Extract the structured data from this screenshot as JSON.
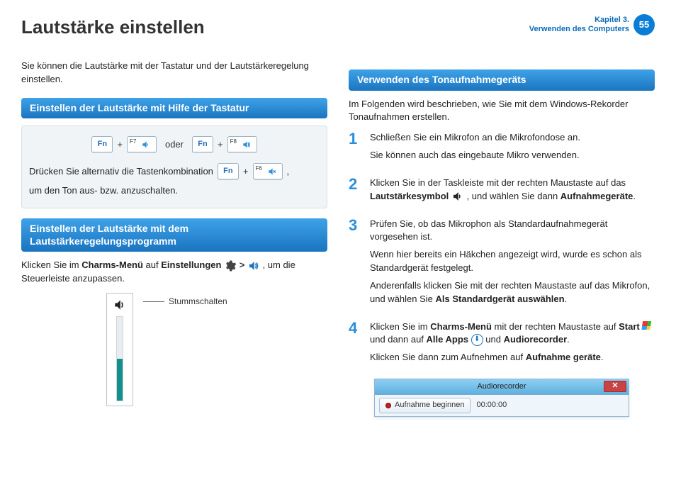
{
  "header": {
    "title": "Lautstärke einstellen",
    "chapter_line1": "Kapitel 3.",
    "chapter_line2": "Verwenden des Computers",
    "page_number": "55"
  },
  "left": {
    "intro": "Sie können die Lautstärke mit der Tastatur und der Lautstärkeregelung einstellen.",
    "section1_title": "Einstellen der Lautstärke mit Hilfe der Tastatur",
    "keys": {
      "fn": "Fn",
      "f7": "F7",
      "f8": "F8",
      "f6": "F6",
      "plus": "+",
      "oder": "oder"
    },
    "alt_text_pre": "Drücken Sie alternativ die Tastenkombination",
    "alt_text_post": ",",
    "alt_text_after": "um den Ton aus- bzw. anzuschalten.",
    "section2_title": "Einstellen der Lautstärke mit dem Lautstärkeregelungsprogramm",
    "charms_pre": "Klicken Sie im ",
    "charms_b1": "Charms-Menü",
    "charms_mid": " auf ",
    "charms_b2": "Einstellungen",
    "charms_gt": ">",
    "charms_post": " , um die Steuerleiste anzupassen.",
    "mute_caption": "Stummschalten"
  },
  "right": {
    "section_title": "Verwenden des Tonaufnahmegeräts",
    "intro": "Im Folgenden wird beschrieben, wie Sie mit dem Windows-Rekorder Tonaufnahmen erstellen.",
    "steps": [
      {
        "n": "1",
        "p1": "Schließen Sie ein Mikrofon an die Mikrofondose an.",
        "p2": "Sie können auch das eingebaute Mikro verwenden."
      },
      {
        "n": "2",
        "p1_pre": "Klicken Sie in der Taskleiste mit der rechten Maustaste auf das ",
        "p1_b": "Lautstärkesymbol",
        "p1_post": " , und wählen Sie dann ",
        "p1_b2": "Aufnahmegeräte",
        "p1_end": "."
      },
      {
        "n": "3",
        "p1": "Prüfen Sie, ob das Mikrophon als Standardaufnahmegerät vorgesehen ist.",
        "p2": "Wenn hier bereits ein Häkchen angezeigt wird, wurde es schon als Standardgerät festgelegt.",
        "p3_pre": "Anderenfalls klicken Sie mit der rechten Maustaste auf das Mikrofon, und wählen Sie ",
        "p3_b": "Als Standardgerät auswählen",
        "p3_end": "."
      },
      {
        "n": "4",
        "p1_pre": "Klicken Sie im ",
        "p1_b1": "Charms-Menü",
        "p1_mid1": " mit der rechten Maustaste auf ",
        "p1_b2": "Start",
        "p1_mid2": " und dann auf ",
        "p1_b3": "Alle Apps",
        "p1_mid3": " und ",
        "p1_b4": "Audiorecorder",
        "p1_end": ".",
        "p2_pre": "Klicken Sie dann zum Aufnehmen auf ",
        "p2_b": "Aufnahme geräte",
        "p2_end": "."
      }
    ],
    "audiorecorder": {
      "title": "Audiorecorder",
      "button": "Aufnahme beginnen",
      "time": "00:00:00"
    }
  }
}
